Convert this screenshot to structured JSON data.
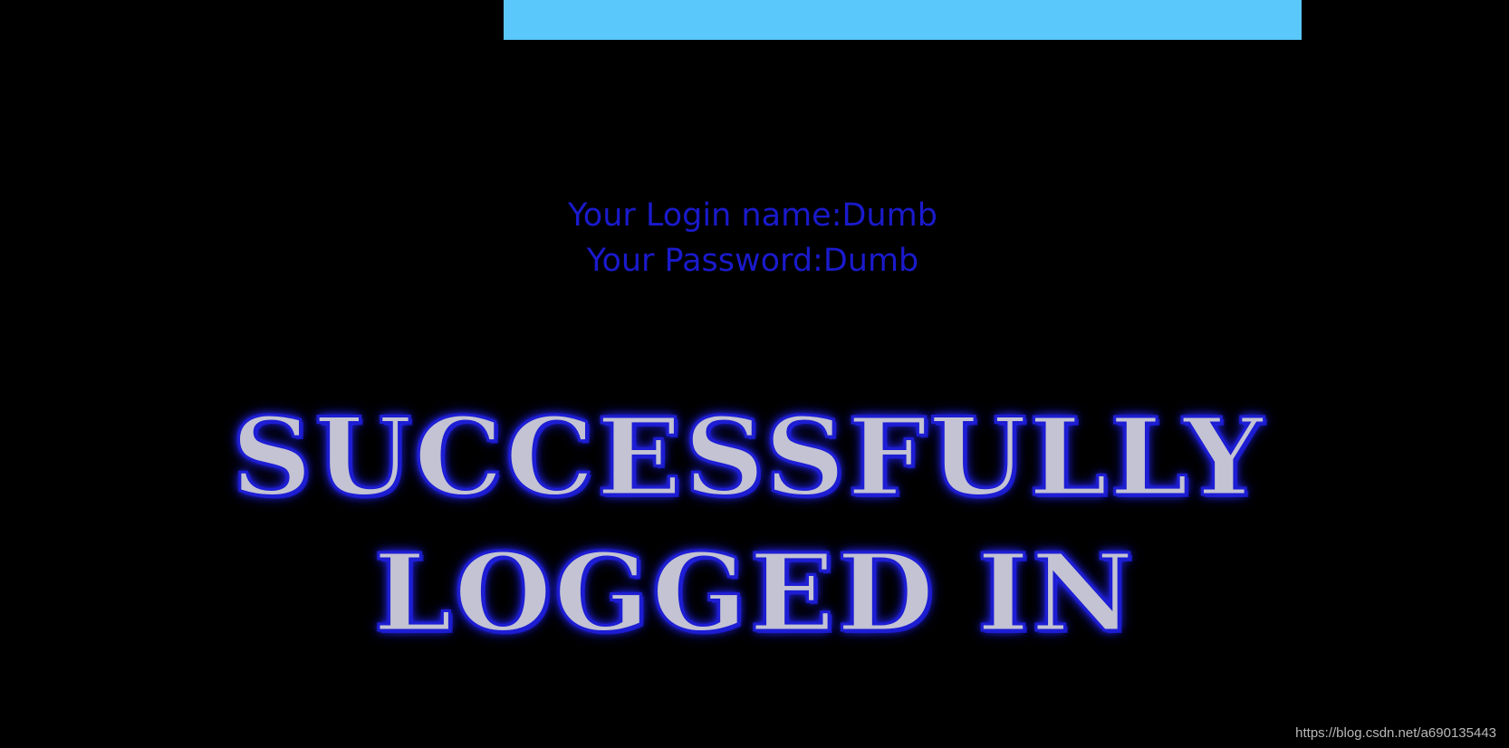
{
  "login": {
    "name_line": "Your Login name:Dumb",
    "password_line": "Your Password:Dumb"
  },
  "banner": {
    "line1": "SUCCESSFULLY",
    "line2": "LOGGED IN"
  },
  "watermark": "https://blog.csdn.net/a690135443",
  "colors": {
    "background": "#000000",
    "top_bar": "#5ac8fa",
    "login_text": "#1a1acc",
    "banner_fill": "#c3c3d3",
    "banner_glow": "#2a2aff"
  }
}
